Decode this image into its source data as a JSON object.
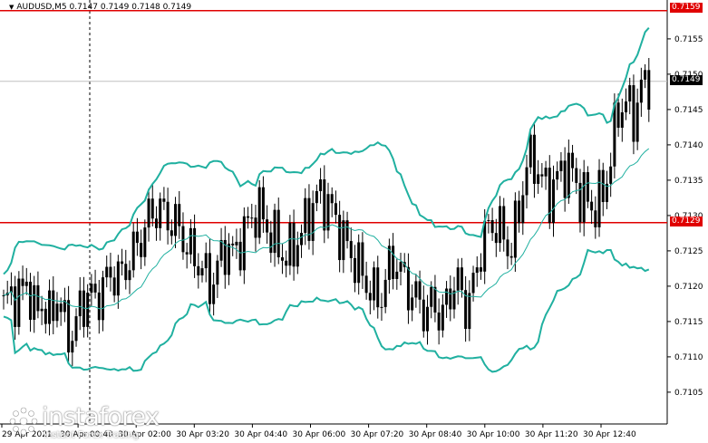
{
  "header": {
    "symbol_line": "AUDUSD,M5  0.7147 0.7149 0.7148 0.7149"
  },
  "price_labels": {
    "top_line": "0.7159",
    "current": "0.7149",
    "support_line": "0.7129"
  },
  "logo": {
    "name": "instaforex",
    "tagline": "Instant Forex Trading"
  },
  "colors": {
    "candles": "#000000",
    "bands": "#20b0a0",
    "level_lines": "#e00000",
    "current_price_line": "#c0c0c0",
    "axis": "#000000"
  },
  "chart_data": {
    "type": "candlestick",
    "symbol": "AUDUSD",
    "timeframe": "M5",
    "ylim": [
      0.71005,
      0.71605
    ],
    "y_ticks": [
      "0.7155",
      "0.7150",
      "0.7145",
      "0.7140",
      "0.7135",
      "0.7130",
      "0.7125",
      "0.7120",
      "0.7115",
      "0.7110",
      "0.7105"
    ],
    "x_ticks": [
      "29 Apr 2021",
      "30 Apr 00:40",
      "30 Apr 02:00",
      "30 Apr 03:20",
      "30 Apr 04:40",
      "30 Apr 06:00",
      "30 Apr 07:20",
      "30 Apr 08:40",
      "30 Apr 10:00",
      "30 Apr 11:20",
      "30 Apr 12:40"
    ],
    "horizontal_levels": [
      0.7159,
      0.7129
    ],
    "current_price": 0.7149,
    "indicator": "Bollinger Bands",
    "close_path": [
      0.7117,
      0.7119,
      0.7118,
      0.7121,
      0.7116,
      0.7118,
      0.7115,
      0.7119,
      0.7114,
      0.7113,
      0.7117,
      0.7119,
      0.7118,
      0.712,
      0.7122,
      0.7121,
      0.7123,
      0.7125,
      0.7127,
      0.713,
      0.7131,
      0.713,
      0.7129,
      0.7128,
      0.7125,
      0.7124,
      0.7122,
      0.712,
      0.7123,
      0.7126,
      0.7124,
      0.7127,
      0.7129,
      0.7131,
      0.7129,
      0.7127,
      0.7125,
      0.7124,
      0.7126,
      0.7128,
      0.7131,
      0.7133,
      0.7132,
      0.713,
      0.7127,
      0.7125,
      0.7123,
      0.7121,
      0.7119,
      0.7118,
      0.7122,
      0.7124,
      0.7121,
      0.7119,
      0.7118,
      0.7116,
      0.7118,
      0.7115,
      0.7119,
      0.7121,
      0.7117,
      0.7119,
      0.7125,
      0.7128,
      0.7129,
      0.7127,
      0.7125,
      0.713,
      0.7137,
      0.7138,
      0.7135,
      0.7133,
      0.7135,
      0.7137,
      0.7136,
      0.7133,
      0.7132,
      0.7131,
      0.7133,
      0.7138,
      0.7145,
      0.7146,
      0.7144,
      0.7148,
      0.7149
    ]
  }
}
